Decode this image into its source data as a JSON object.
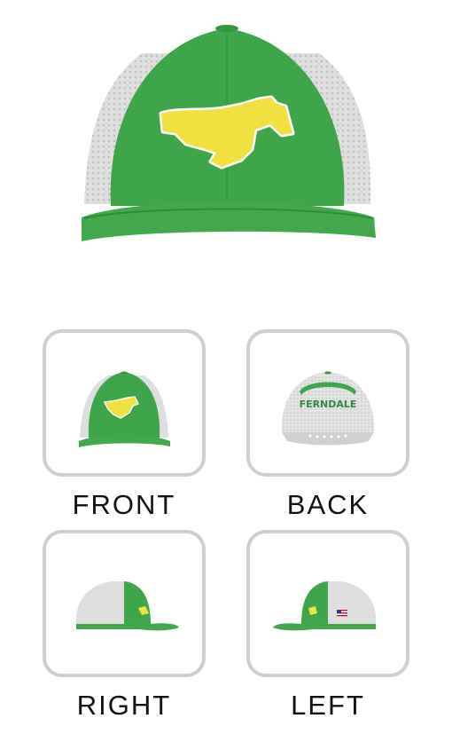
{
  "product": {
    "colors": {
      "crown": "#3fa54a",
      "crown_shadow": "#2f8a3b",
      "mesh": "#d9d9d9",
      "logo": "#f0e040",
      "logo_outline": "#ffffff"
    }
  },
  "views": [
    {
      "label": "FRONT"
    },
    {
      "label": "BACK",
      "embroidery": "FERNDALE"
    },
    {
      "label": "RIGHT"
    },
    {
      "label": "LEFT"
    }
  ]
}
